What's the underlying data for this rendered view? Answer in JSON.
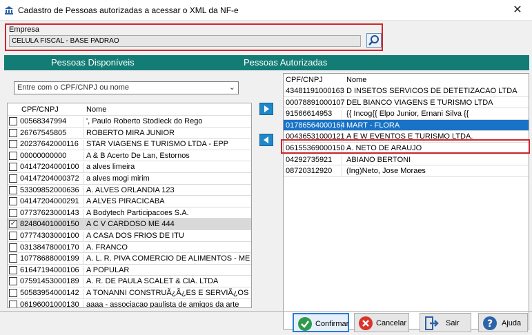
{
  "window": {
    "title": "Cadastro de Pessoas autorizadas a acessar o XML da NF-e",
    "close_glyph": "✕"
  },
  "empresa": {
    "label": "Empresa",
    "value": "CELULA FISCAL - BASE PADRAO"
  },
  "sections": {
    "disponiveis_title": "Pessoas Disponíveis",
    "autorizadas_title": "Pessoas Autorizadas"
  },
  "filter": {
    "text": "Entre com o CPF/CNPJ ou nome"
  },
  "left_grid": {
    "columns": [
      "CPF/CNPJ",
      "Nome"
    ],
    "rows": [
      {
        "id": "00568347994",
        "name": "', Paulo Roberto Stodieck do Rego",
        "checked": false
      },
      {
        "id": "26767545805",
        "name": "ROBERTO MIRA JUNIOR",
        "checked": false
      },
      {
        "id": "20237642000116",
        "name": "STAR VIAGENS E TURISMO LTDA - EPP",
        "checked": false
      },
      {
        "id": "00000000000",
        "name": "A & B Acerto De Lan, Estornos",
        "checked": false
      },
      {
        "id": "04147204000100",
        "name": "a alves limeira",
        "checked": false
      },
      {
        "id": "04147204000372",
        "name": "a alves mogi mirim",
        "checked": false
      },
      {
        "id": "53309852000636",
        "name": "A. ALVES ORLANDIA 123",
        "checked": false
      },
      {
        "id": "04147204000291",
        "name": "A ALVES PIRACICABA",
        "checked": false
      },
      {
        "id": "07737623000143",
        "name": "A Bodytech Participacoes S.A.",
        "checked": false
      },
      {
        "id": "82480401000150",
        "name": "A C V CARDOSO ME 444",
        "checked": true
      },
      {
        "id": "07774303000100",
        "name": "A CASA DOS FRIOS DE ITU",
        "checked": false
      },
      {
        "id": "03138478000170",
        "name": "A. FRANCO",
        "checked": false
      },
      {
        "id": "10778688000199",
        "name": "A. L. R. PIVA COMERCIO DE ALIMENTOS - ME",
        "checked": false
      },
      {
        "id": "61647194000106",
        "name": "A POPULAR",
        "checked": false
      },
      {
        "id": "07591453000189",
        "name": "A. R. DE PAULA SCALET & CIA. LTDA",
        "checked": false
      },
      {
        "id": "50583954000142",
        "name": "A TONANNI CONSTRUÃ¿Ã¿ES E SERVIÃ¿OS LTDA",
        "checked": false
      },
      {
        "id": "06196001000130",
        "name": "aaaa - associacao paulista de amigos da arte",
        "checked": false
      }
    ]
  },
  "right_grid": {
    "columns": [
      "CPF/CNPJ",
      "Nome"
    ],
    "rows": [
      {
        "id": "43481191000163",
        "name": "D INSETOS SERVICOS DE DETETIZACAO LTDA"
      },
      {
        "id": "00078891000107",
        "name": "DEL BIANCO VIAGENS E TURISMO LTDA"
      },
      {
        "id": "91566614953",
        "name": "{{ Incog{{ Elpo Junior, Ernani Silva {{"
      },
      {
        "id": "01786564000164",
        "name": "MART - FLORA",
        "selected": true
      },
      {
        "id": "00436531000121",
        "name": "A E W EVENTOS E TURISMO LTDA."
      },
      {
        "id": "06155369000150",
        "name": "A. NETO DE ARAUJO"
      },
      {
        "id": "04292735921",
        "name": "ABIANO BERTONI"
      },
      {
        "id": "08720312920",
        "name": "(Ing)Neto, Jose Moraes"
      }
    ]
  },
  "buttons": {
    "confirmar": "Confirmar",
    "cancelar": "Cancelar",
    "sair": "Sair",
    "ajuda": "Ajuda"
  },
  "icons": {
    "app": "bank-icon",
    "search": "magnifier-icon",
    "move_right": "arrow-right-icon",
    "move_left": "arrow-left-icon",
    "confirm": "check-icon",
    "cancel": "x-circle-icon",
    "exit": "exit-door-icon",
    "help": "question-icon"
  },
  "colors": {
    "teal_header": "#137d75",
    "selection_blue": "#1873c6",
    "highlight_red": "#d0262b"
  }
}
